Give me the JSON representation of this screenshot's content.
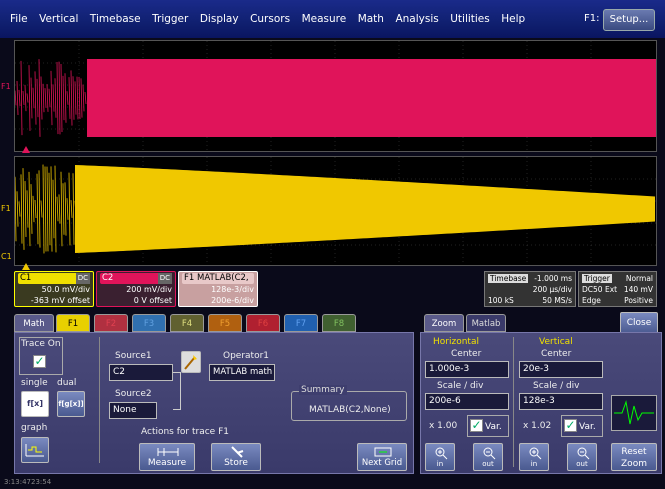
{
  "menu": [
    "File",
    "Vertical",
    "Timebase",
    "Trigger",
    "Display",
    "Cursors",
    "Measure",
    "Math",
    "Analysis",
    "Utilities",
    "Help"
  ],
  "menu_right": {
    "active_function": "F1:",
    "setup_label": "Setup..."
  },
  "traces": {
    "top_label": "F1",
    "bottom_labels": [
      "F1",
      "C1"
    ],
    "colors": {
      "f1": "#e0145a",
      "c1": "#f0c800"
    }
  },
  "descriptors": {
    "c1": {
      "name": "C1",
      "badge": "DC",
      "line1": "50.0 mV/div",
      "line2": "-363 mV offset"
    },
    "c2": {
      "name": "C2",
      "badge": "DC",
      "line1": "200 mV/div",
      "line2": "0 V offset"
    },
    "f1": {
      "name": "F1",
      "formula": "MATLAB(C2,",
      "line1": "128e-3/div",
      "line2": "200e-6/div"
    }
  },
  "timebase": {
    "label": "Timebase",
    "value": "-1.000 ms",
    "line2": "200 µs/div",
    "line3a": "100 kS",
    "line3b": "50 MS/s"
  },
  "trigger": {
    "label": "Trigger",
    "value": "Normal",
    "line2a": "DC50",
    "line2b": "Ext",
    "line2c": "140 mV",
    "line3a": "Edge",
    "line3b": "Positive"
  },
  "math_panel": {
    "tabs": [
      "Math",
      "F1",
      "F2",
      "F3",
      "F4",
      "F5",
      "F6",
      "F7",
      "F8"
    ],
    "trace_on_label": "Trace On",
    "single_label": "single",
    "dual_label": "dual",
    "single_icon": "f[x]",
    "dual_icon": "f[g[x]]",
    "graph_label": "graph",
    "source1_label": "Source1",
    "source1_value": "C2",
    "operator1_label": "Operator1",
    "operator1_value": "MATLAB math",
    "source2_label": "Source2",
    "source2_value": "None",
    "summary_label": "Summary",
    "summary_value": "MATLAB(C2,None)",
    "actions_label": "Actions for trace F1",
    "measure_label": "Measure",
    "store_label": "Store",
    "next_grid_label": "Next Grid"
  },
  "zoom_panel": {
    "tabs": [
      "Zoom",
      "Matlab"
    ],
    "close_label": "Close",
    "horizontal_label": "Horizontal",
    "vertical_label": "Vertical",
    "center_label": "Center",
    "h_center": "1.000e-3",
    "v_center": "20e-3",
    "scale_label": "Scale / div",
    "h_scale": "200e-6",
    "v_scale": "128e-3",
    "h_factor": "x 1.00",
    "v_factor": "x 1.02",
    "var_label": "Var.",
    "in_label": "in",
    "out_label": "out",
    "reset_zoom_label": "Reset Zoom"
  },
  "status_text": "3:13:4723:54"
}
